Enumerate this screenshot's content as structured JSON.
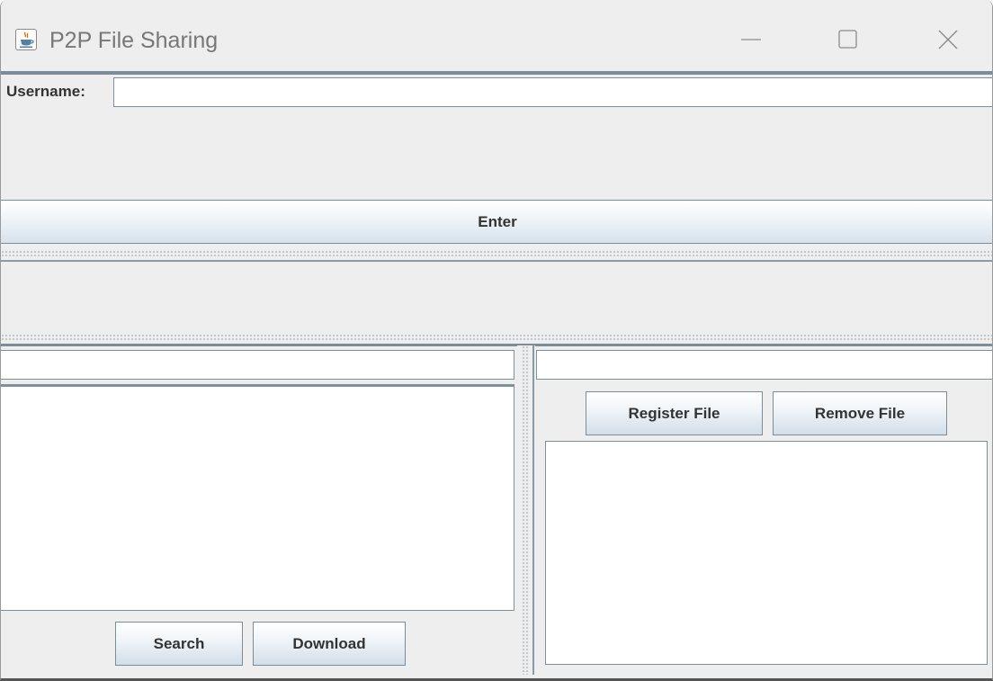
{
  "window": {
    "title": "P2P File Sharing",
    "app_icon": "java-cup-icon",
    "controls": {
      "minimize": "minimize-icon",
      "maximize": "maximize-icon",
      "close": "close-icon"
    }
  },
  "login": {
    "username_label": "Username:",
    "username_value": "",
    "enter_label": "Enter"
  },
  "left_pane": {
    "search_value": "",
    "results": [],
    "search_label": "Search",
    "download_label": "Download"
  },
  "right_pane": {
    "file_path_value": "",
    "register_label": "Register File",
    "remove_label": "Remove File",
    "registered_files": []
  },
  "colors": {
    "window_bg": "#eeeeee",
    "border": "#7d8c99",
    "button_gradient_bottom": "#d7e2ec",
    "text": "#333333"
  }
}
